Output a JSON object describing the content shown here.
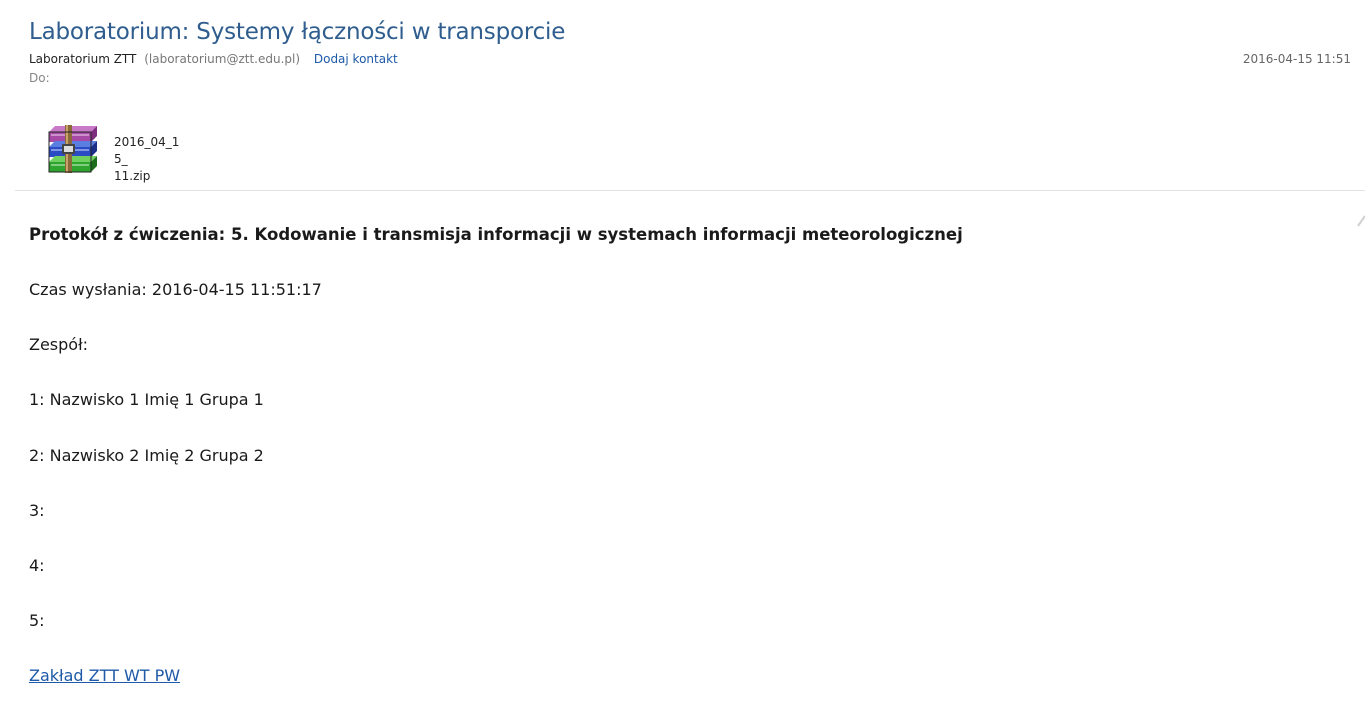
{
  "message": {
    "subject": "Laboratorium: Systemy łączności w transporcie",
    "sender_name": "Laboratorium ZTT",
    "sender_email": "(laboratorium@ztt.edu.pl)",
    "add_contact_label": "Dodaj kontakt",
    "date": "2016-04-15 11:51",
    "to_label": "Do:"
  },
  "attachment": {
    "filename_line1": "2016_04_15_",
    "filename_line2": "11.zip",
    "icon": "winrar-archive-icon"
  },
  "body": {
    "heading": "Protokół z ćwiczenia: 5. Kodowanie i transmisja informacji w systemach informacji meteorologicznej",
    "sent_time": "Czas wysłania: 2016-04-15 11:51:17",
    "team_label": "Zespół:",
    "members": [
      "1: Nazwisko 1 Imię 1 Grupa 1",
      "2: Nazwisko 2 Imię 2 Grupa 2",
      "3:",
      "4:",
      "5:"
    ],
    "footer_link": "Zakład ZTT WT PW"
  }
}
